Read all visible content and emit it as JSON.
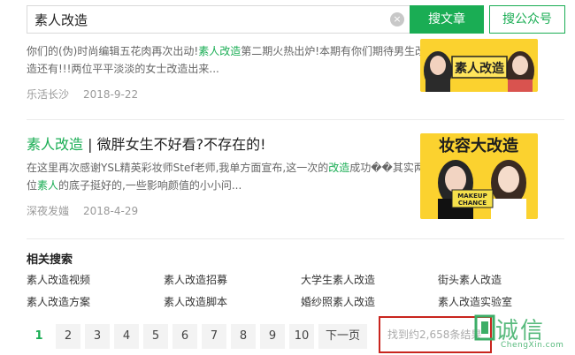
{
  "search": {
    "query": "素人改造",
    "clear_label": "×",
    "article_button": "搜文章",
    "account_button": "搜公众号"
  },
  "results": [
    {
      "snippet_parts": [
        {
          "text": "你们的(伪)时尚编辑五花肉再次出动!",
          "hl": false
        },
        {
          "text": "素人改造",
          "hl": true
        },
        {
          "text": "第二期火热出炉!本期有你们期待男生改造还有!!!两位平平淡淡的女士改造出来...",
          "hl": false
        }
      ],
      "source": "乐活长沙",
      "date": "2018-9-22",
      "thumb_text": "素人改造"
    },
    {
      "title_highlight": "素人改造",
      "title_rest": " | 微胖女生不好看?不存在的!",
      "snippet_parts": [
        {
          "text": "在这里再次感谢YSL精英彩妆师Stef老师,我单方面宣布,这一次的",
          "hl": false
        },
        {
          "text": "改造",
          "hl": true
        },
        {
          "text": "成功��其实两位",
          "hl": false
        },
        {
          "text": "素人",
          "hl": true
        },
        {
          "text": "的底子挺好的,一些影响颜值的小小问...",
          "hl": false
        }
      ],
      "source": "深夜发媸",
      "date": "2018-4-29",
      "thumb_text": "妆容大改造",
      "thumb_badge_1": "MAKEUP",
      "thumb_badge_2": "CHANCE"
    }
  ],
  "related": {
    "title": "相关搜索",
    "items": [
      "素人改造视频",
      "素人改造招募",
      "大学生素人改造",
      "街头素人改造",
      "素人改造方案",
      "素人改造脚本",
      "婚纱照素人改造",
      "素人改造实验室"
    ]
  },
  "pagination": {
    "pages": [
      "1",
      "2",
      "3",
      "4",
      "5",
      "6",
      "7",
      "8",
      "9",
      "10"
    ],
    "current": "1",
    "next_label": "下一页",
    "result_count": "找到约2,658条结果"
  },
  "watermark": {
    "cn": "诚信",
    "en": "ChengXin.com"
  },
  "colors": {
    "accent": "#1aad54",
    "highlight_box": "#c9251e"
  }
}
